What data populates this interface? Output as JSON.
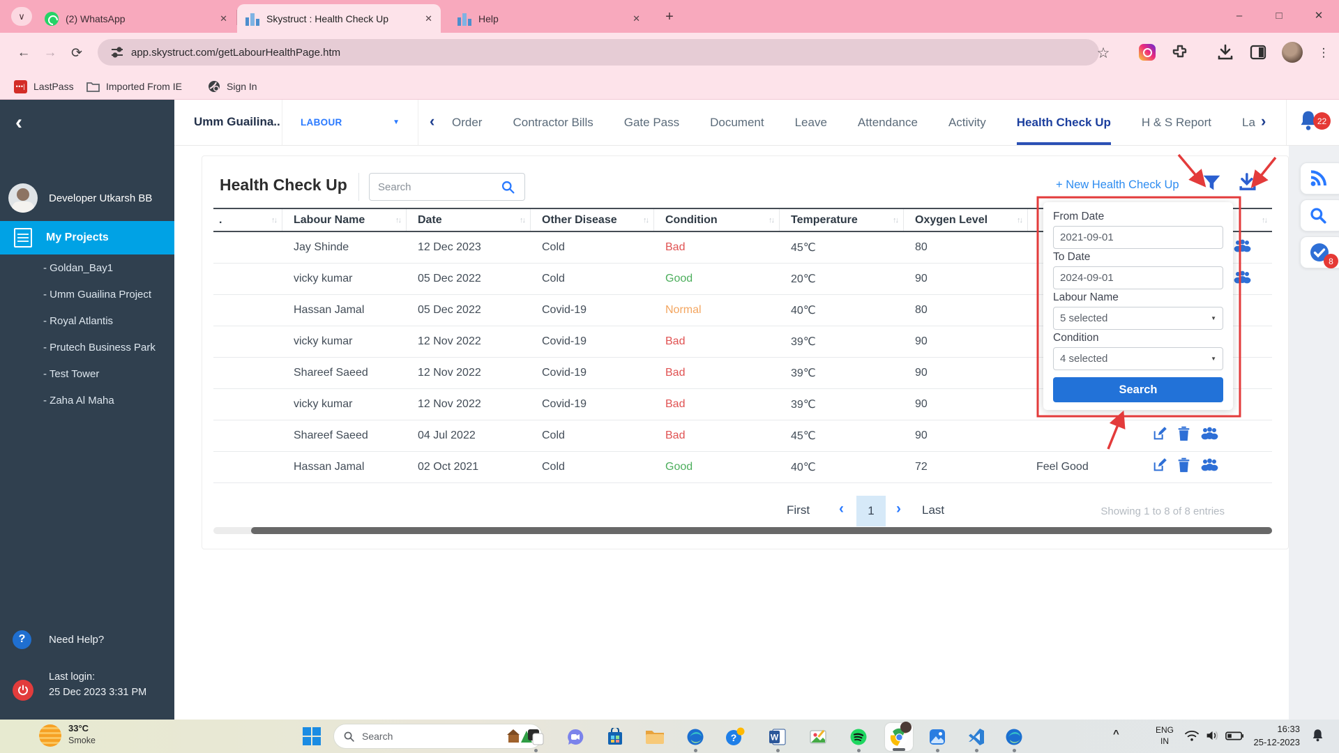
{
  "glyphs": {
    "tab_search": "∨",
    "close": "✕",
    "plus": "+",
    "minimize": "–",
    "maximize": "□",
    "back": "←",
    "forward": "→",
    "reload": "⟳",
    "star": "☆",
    "kebab": "⋮",
    "caret_down": "▼",
    "chevron_left": "‹",
    "chevron_right": "›",
    "tray_expand": "^",
    "lastpass_dots": "•••|",
    "question": "?"
  },
  "colors": {
    "accent_blue": "#2979ff",
    "sidebar_highlight": "#00a2e5",
    "annotation_red": "#e33b3b",
    "condition_bad": "#e05252",
    "condition_good": "#4cae5c",
    "condition_normal": "#f3a55f"
  },
  "browser": {
    "tab_whatsapp": "(2) WhatsApp",
    "tab_app": "Skystruct : Health Check Up",
    "tab_help": "Help",
    "url": "app.skystruct.com/getLabourHealthPage.htm",
    "bookmark_lastpass": "LastPass",
    "bookmark_imported": "Imported From IE",
    "bookmark_signin": "Sign In"
  },
  "nav": {
    "project": "Umm Guailina..",
    "module": "LABOUR",
    "tabs": [
      {
        "label": "Order"
      },
      {
        "label": "Contractor Bills"
      },
      {
        "label": "Gate Pass"
      },
      {
        "label": "Document"
      },
      {
        "label": "Leave"
      },
      {
        "label": "Attendance"
      },
      {
        "label": "Activity"
      },
      {
        "label": "Health Check Up",
        "active": true
      },
      {
        "label": "H & S Report"
      },
      {
        "label": "La"
      }
    ],
    "bell_badge": "22"
  },
  "sidebar": {
    "user": "Developer Utkarsh BB",
    "my_projects": "My Projects",
    "projects": [
      "- Goldan_Bay1",
      "- Umm Guailina Project",
      "- Royal Atlantis",
      "- Prutech Business Park",
      "- Test Tower",
      "- Zaha Al Maha"
    ],
    "need_help": "Need Help?",
    "last_login_label": "Last login:",
    "last_login_value": "25 Dec 2023 3:31 PM"
  },
  "page": {
    "title": "Health Check Up",
    "search_placeholder": "Search",
    "new_link": "+ New Health Check Up",
    "pagination": {
      "first": "First",
      "page": "1",
      "last": "Last",
      "showing": "Showing 1 to 8 of 8 entries"
    }
  },
  "table": {
    "columns": [
      {
        "label": ".",
        "sort": "↑↓"
      },
      {
        "label": "Labour Name",
        "sort": "↑↓"
      },
      {
        "label": "Date",
        "sort": "↑↓"
      },
      {
        "label": "Other Disease",
        "sort": "↑↓"
      },
      {
        "label": "Condition",
        "sort": "↑↓"
      },
      {
        "label": "Temperature",
        "sort": "↑↓"
      },
      {
        "label": "Oxygen Level",
        "sort": "↑↓"
      },
      {
        "label": "",
        "sort": "↑↓"
      },
      {
        "label": "",
        "sort": "↑↓"
      }
    ],
    "rows": [
      {
        "labour_name": "Jay Shinde",
        "date": "12 Dec 2023",
        "other_disease": "Cold",
        "condition": "Bad",
        "condition_color": "#e05252",
        "temperature": "45℃",
        "oxygen_level": "80",
        "comment": ""
      },
      {
        "labour_name": "vicky kumar",
        "date": "05 Dec 2022",
        "other_disease": "Cold",
        "condition": "Good",
        "condition_color": "#4cae5c",
        "temperature": "20℃",
        "oxygen_level": "90",
        "comment": ""
      },
      {
        "labour_name": "Hassan Jamal",
        "date": "05 Dec 2022",
        "other_disease": "Covid-19",
        "condition": "Normal",
        "condition_color": "#f3a55f",
        "temperature": "40℃",
        "oxygen_level": "80",
        "comment": ""
      },
      {
        "labour_name": "vicky kumar",
        "date": "12 Nov 2022",
        "other_disease": "Covid-19",
        "condition": "Bad",
        "condition_color": "#e05252",
        "temperature": "39℃",
        "oxygen_level": "90",
        "comment": ""
      },
      {
        "labour_name": "Shareef Saeed",
        "date": "12 Nov 2022",
        "other_disease": "Covid-19",
        "condition": "Bad",
        "condition_color": "#e05252",
        "temperature": "39℃",
        "oxygen_level": "90",
        "comment": ""
      },
      {
        "labour_name": "vicky kumar",
        "date": "12 Nov 2022",
        "other_disease": "Covid-19",
        "condition": "Bad",
        "condition_color": "#e05252",
        "temperature": "39℃",
        "oxygen_level": "90",
        "comment": ""
      },
      {
        "labour_name": "Shareef Saeed",
        "date": "04 Jul 2022",
        "other_disease": "Cold",
        "condition": "Bad",
        "condition_color": "#e05252",
        "temperature": "45℃",
        "oxygen_level": "90",
        "comment": ""
      },
      {
        "labour_name": "Hassan Jamal",
        "date": "02 Oct 2021",
        "other_disease": "Cold",
        "condition": "Good",
        "condition_color": "#4cae5c",
        "temperature": "40℃",
        "oxygen_level": "72",
        "comment": "Feel Good"
      }
    ]
  },
  "filter": {
    "from_label": "From Date",
    "from_value": "2021-09-01",
    "to_label": "To Date",
    "to_value": "2024-09-01",
    "labour_label": "Labour Name",
    "labour_value": "5 selected",
    "condition_label": "Condition",
    "condition_value": "4 selected",
    "search_button": "Search"
  },
  "floating": {
    "todo_badge": "8"
  },
  "taskbar": {
    "weather_temp": "33°C",
    "weather_desc": "Smoke",
    "search_placeholder": "Search",
    "lang_line1": "ENG",
    "lang_line2": "IN",
    "time": "16:33",
    "date": "25-12-2023"
  }
}
